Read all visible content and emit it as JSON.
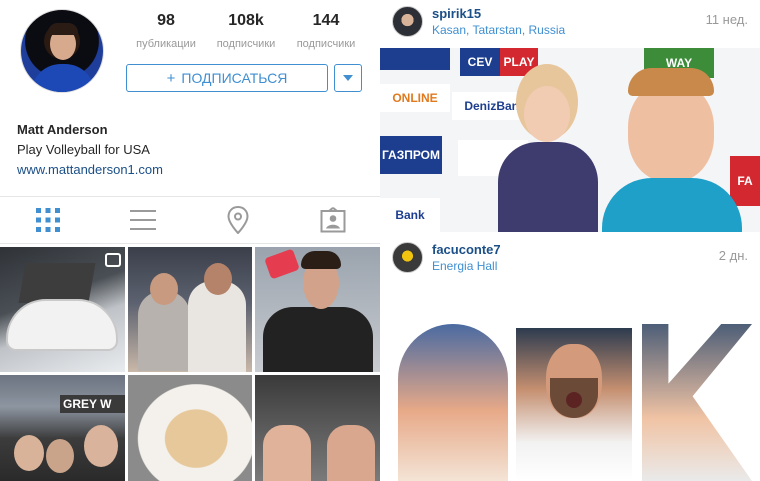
{
  "profile": {
    "name": "Matt Anderson",
    "bio": "Play Volleyball for USA",
    "website": "www.mattanderson1.com",
    "stats": [
      {
        "value": "98",
        "label": "публикации"
      },
      {
        "value": "108k",
        "label": "подписчики"
      },
      {
        "value": "144",
        "label": "подписчики"
      }
    ],
    "follow_button": {
      "icon": "+",
      "label": "ПОДПИСАТЬСЯ"
    },
    "tabs": [
      "grid-icon",
      "list-icon",
      "location-pin-icon",
      "tagged-user-icon"
    ],
    "grid_sign_text": "GREY W"
  },
  "feed": {
    "posts": [
      {
        "username": "spirik15",
        "location": "Kasan, Tatarstan, Russia",
        "time": "11 нед."
      },
      {
        "username": "facuconte7",
        "location": "Energia Hall",
        "time": "2 дн."
      }
    ],
    "sponsor_boards": [
      "CEV",
      "PLAY",
      "ONLINE",
      "DenizBank",
      "ГАЗПРОМ",
      "WAY",
      "Bank",
      "FA"
    ]
  },
  "colors": {
    "link_blue": "#3f8fd1",
    "username_blue": "#1b4f87",
    "muted": "#999999"
  }
}
